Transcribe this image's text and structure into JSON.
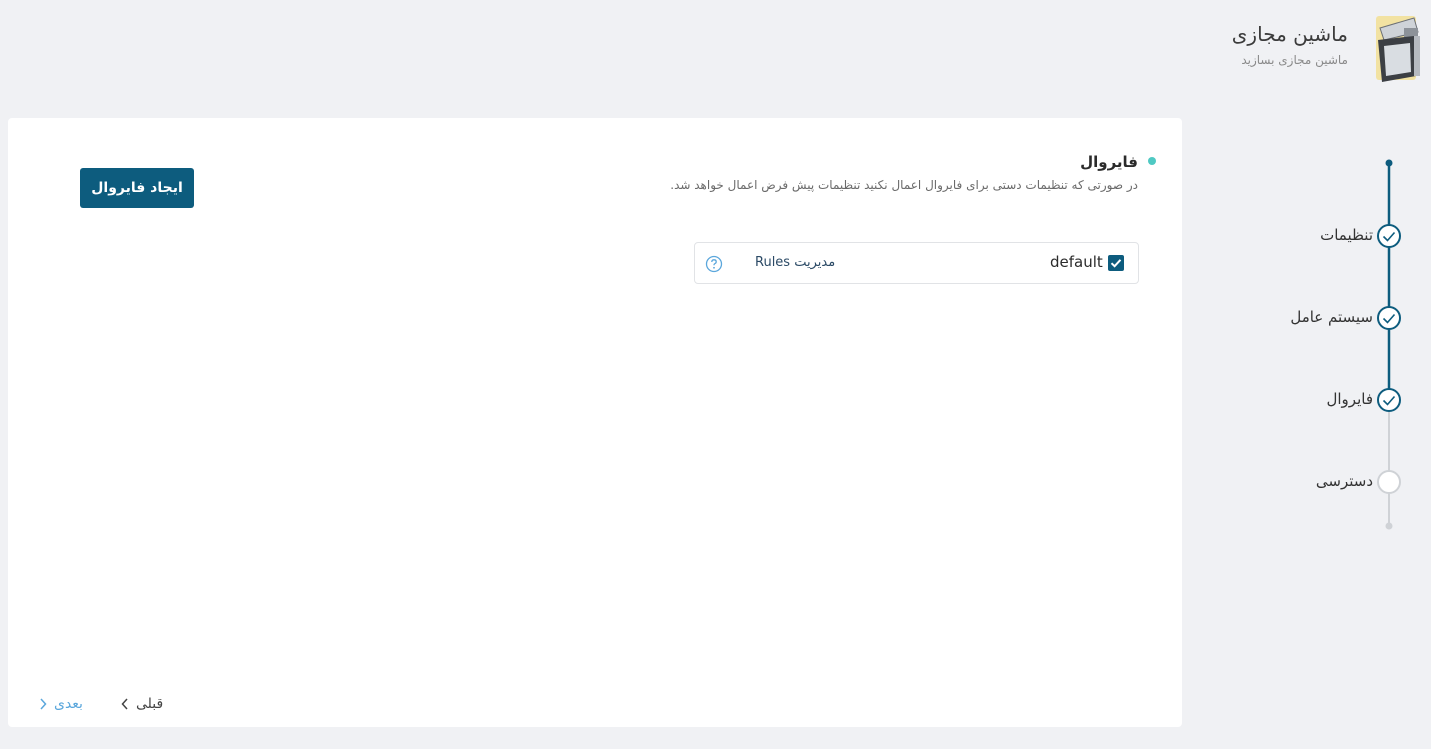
{
  "header": {
    "title": "ماشین مجازی",
    "subtitle": "ماشین مجازی بسازید",
    "logo_icon": "virtual-machine-icon"
  },
  "section": {
    "title": "فایروال",
    "description": "در صورتی که تنظیمات دستی برای فایروال اعمال نکنید تنظیمات پیش فرض اعمال خواهد شد.",
    "create_button": "ایجاد فایروال"
  },
  "firewalls": [
    {
      "name": "default",
      "checked": true,
      "manage_label": "مدیریت Rules",
      "help_icon": "question-icon"
    }
  ],
  "nav": {
    "prev": "قبلی",
    "next": "بعدی"
  },
  "steps": [
    {
      "label": "تنظیمات",
      "completed": true
    },
    {
      "label": "سیستم عامل",
      "completed": true
    },
    {
      "label": "فایروال",
      "completed": true
    },
    {
      "label": "دسترسی",
      "completed": false
    }
  ],
  "colors": {
    "primary": "#0d5c7e",
    "accent_dot": "#4fc9c3",
    "link": "#5ba7dc",
    "inactive": "#cfd2d6"
  }
}
